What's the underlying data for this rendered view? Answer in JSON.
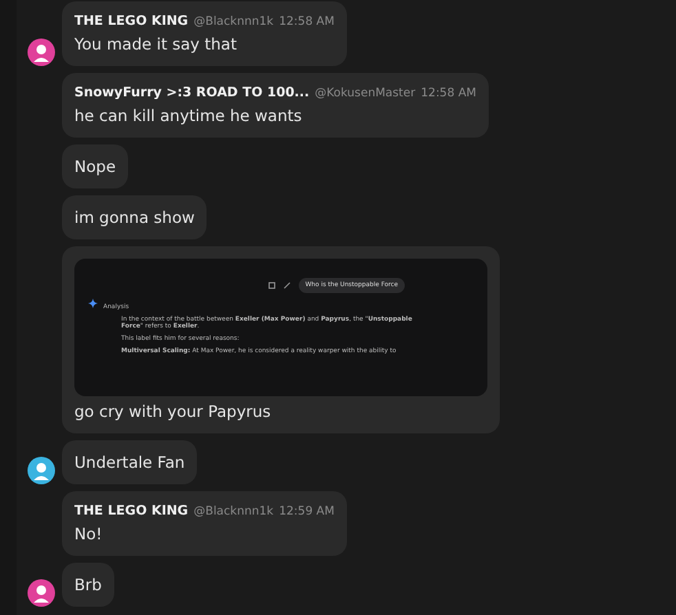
{
  "messages": [
    {
      "author": "THE LEGO KING",
      "handle": "@Blacknnn1k",
      "time": "12:58 AM",
      "text": "You made it say that",
      "avatar": {
        "color": "#e0409a"
      }
    },
    {
      "author": "SnowyFurry >:3 ROAD TO 100...",
      "handle": "@KokusenMaster",
      "time": "12:58 AM",
      "text": "he can kill anytime he wants"
    },
    {
      "text": "Nope"
    },
    {
      "text": "im gonna show"
    },
    {
      "text": "go cry with your Papyrus",
      "attachment": {
        "prompt": "Who is the Unstoppable Force",
        "section": "Analysis",
        "paragraph": "In the context of the battle between **Exeller (Max Power)** and **Papyrus**, the \"**Unstoppable Force**\" refers to **Exeller**.",
        "intro": "This label fits him for several reasons:",
        "bullet": "**Multiversal Scaling:** At Max Power, he is considered a reality warper with the ability to"
      }
    },
    {
      "text": "Undertale Fan",
      "avatar": {
        "color": "#3ab3e0"
      }
    },
    {
      "author": "THE LEGO KING",
      "handle": "@Blacknnn1k",
      "time": "12:59 AM",
      "text": "No!"
    },
    {
      "text": "Brb",
      "avatar": {
        "color": "#e0409a"
      }
    }
  ]
}
